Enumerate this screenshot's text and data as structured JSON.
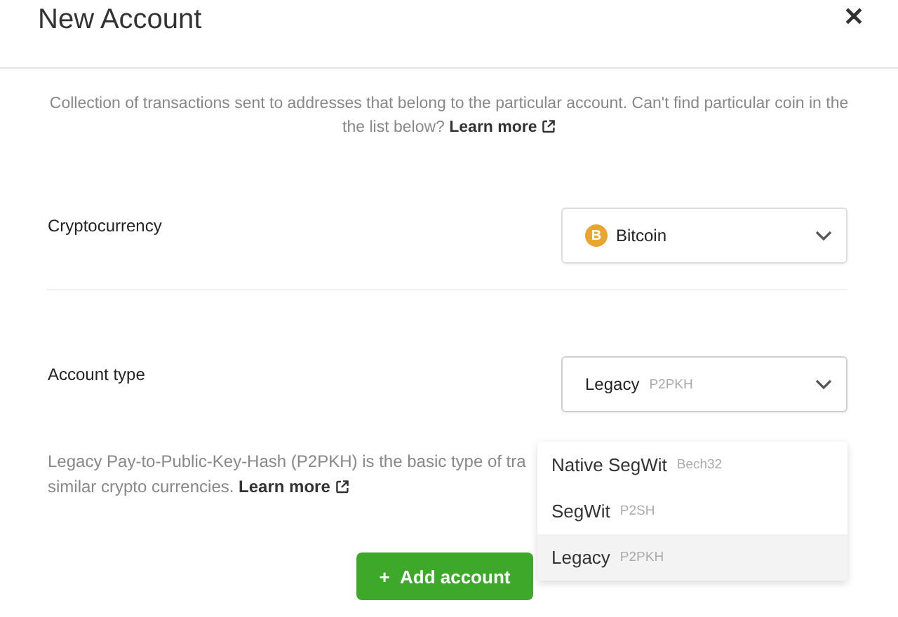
{
  "dialog": {
    "title": "New Account",
    "close": "✕"
  },
  "intro": {
    "text": "Collection of transactions sent to addresses that belong to the particular account. Can't find particular coin in the the list below?",
    "link": "Learn more"
  },
  "cryptocurrency": {
    "label": "Cryptocurrency",
    "value": "Bitcoin",
    "coin_symbol": "B"
  },
  "account_type": {
    "label": "Account type",
    "value": "Legacy",
    "code": "P2PKH",
    "expanded": true,
    "options": [
      {
        "name": "Native SegWit",
        "code": "Bech32",
        "selected": false
      },
      {
        "name": "SegWit",
        "code": "P2SH",
        "selected": false
      },
      {
        "name": "Legacy",
        "code": "P2PKH",
        "selected": true
      }
    ]
  },
  "description": {
    "lines": [
      "Legacy Pay-to-Public-Key-Hash (P2PKH) is the basic type of tra",
      "similar crypto currencies."
    ],
    "link": "Learn more"
  },
  "submit": {
    "icon": "+",
    "label": "Add account"
  }
}
